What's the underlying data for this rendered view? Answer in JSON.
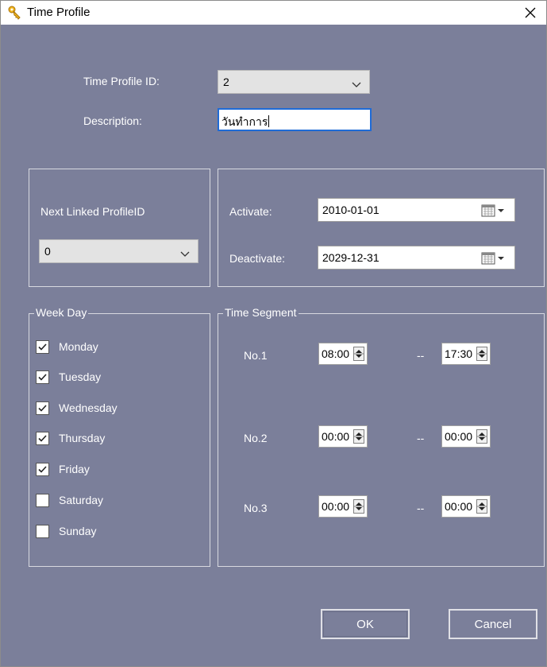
{
  "window": {
    "title": "Time Profile"
  },
  "profile": {
    "id_label": "Time Profile ID:",
    "id_value": "2",
    "description_label": "Description:",
    "description_value": "วันทำการ"
  },
  "linked": {
    "label": "Next Linked ProfileID",
    "value": "0"
  },
  "dates": {
    "activate_label": "Activate:",
    "activate_value": "2010-01-01",
    "deactivate_label": "Deactivate:",
    "deactivate_value": "2029-12-31"
  },
  "week_day": {
    "title": "Week Day",
    "days": [
      {
        "label": "Monday",
        "checked": true
      },
      {
        "label": "Tuesday",
        "checked": true
      },
      {
        "label": "Wednesday",
        "checked": true
      },
      {
        "label": "Thursday",
        "checked": true
      },
      {
        "label": "Friday",
        "checked": true
      },
      {
        "label": "Saturday",
        "checked": false
      },
      {
        "label": "Sunday",
        "checked": false
      }
    ]
  },
  "time_segment": {
    "title": "Time Segment",
    "separator": "--",
    "segments": [
      {
        "label": "No.1",
        "start": "08:00",
        "end": "17:30"
      },
      {
        "label": "No.2",
        "start": "00:00",
        "end": "00:00"
      },
      {
        "label": "No.3",
        "start": "00:00",
        "end": "00:00"
      }
    ]
  },
  "buttons": {
    "ok": "OK",
    "cancel": "Cancel"
  }
}
